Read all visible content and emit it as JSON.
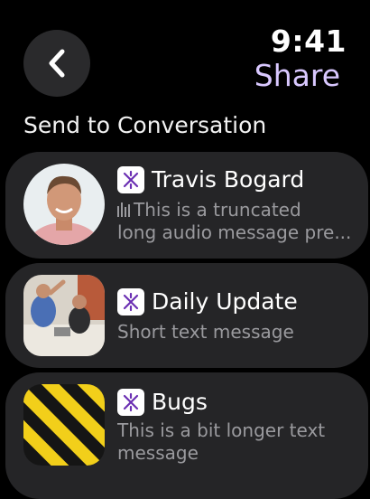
{
  "status": {
    "time": "9:41"
  },
  "header": {
    "title": "Share"
  },
  "section": {
    "label": "Send to Conversation"
  },
  "conversations": [
    {
      "name": "Travis Bogard",
      "message_line1": "This is a truncated",
      "message_line2": "long audio message pre...",
      "type": "audio"
    },
    {
      "name": "Daily Update",
      "message_line1": "Short text message"
    },
    {
      "name": "Bugs",
      "message_line1": "This is a bit longer text",
      "message_line2": "message"
    }
  ],
  "colors": {
    "accent": "#d9c8ff",
    "card": "#252527",
    "secondary_text": "#9a9a9e"
  }
}
